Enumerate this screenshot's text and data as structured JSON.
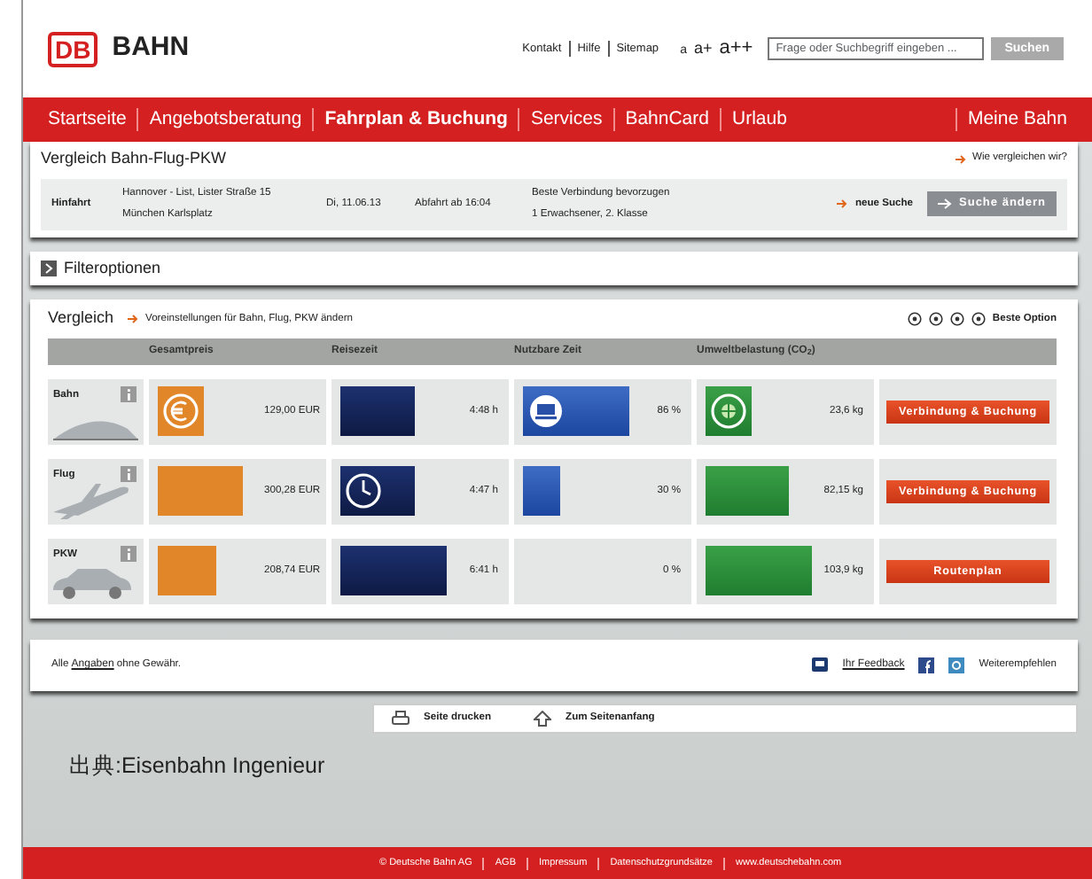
{
  "header": {
    "logo_mark": "DB",
    "logo_text": "BAHN",
    "links": [
      "Kontakt",
      "Hilfe",
      "Sitemap"
    ],
    "font_sizes": [
      "a",
      "a+",
      "a++"
    ],
    "search": {
      "placeholder": "Frage oder Suchbegriff eingeben ..."
    },
    "search_button": "Suchen"
  },
  "nav": {
    "items": [
      {
        "label": "Startseite",
        "selected": false
      },
      {
        "label": "Angebotsberatung",
        "selected": false
      },
      {
        "label": "Fahrplan & Buchung",
        "selected": true
      },
      {
        "label": "Services",
        "selected": false
      },
      {
        "label": "BahnCard",
        "selected": false
      },
      {
        "label": "Urlaub",
        "selected": false
      }
    ],
    "account": "Meine Bahn"
  },
  "search_panel": {
    "title": "Vergleich Bahn-Flug-PKW",
    "help_link": "Wie vergleichen wir?",
    "direction": "Hinfahrt",
    "from": "Hannover - List, Lister Straße 15",
    "to": "München Karlsplatz",
    "date": "Di, 11.06.13",
    "departure": "Abfahrt ab 16:04",
    "preference": "Beste Verbindung bevorzugen",
    "travellers": "1 Erwachsener, 2. Klasse",
    "new_search": "neue Suche",
    "change_button": "Suche ändern"
  },
  "filter": {
    "title": "Filteroptionen"
  },
  "comparison": {
    "title": "Vergleich",
    "settings_link": "Voreinstellungen für Bahn, Flug, PKW ändern",
    "legend": "Beste Option",
    "columns": [
      "Gesamtpreis",
      "Reisezeit",
      "Nutzbare Zeit",
      "Umweltbelastung (CO$_{2}$)"
    ],
    "rows": [
      {
        "kind": "train",
        "mode": "Bahn",
        "metrics": [
          {
            "value": "129,00 EUR",
            "best": true
          },
          {
            "value": "4:48 h",
            "best": false
          },
          {
            "value": "86 %",
            "best": true
          },
          {
            "value": "23,6 kg",
            "best": true
          }
        ],
        "action": "Verbindung & Buchung"
      },
      {
        "kind": "plane",
        "mode": "Flug",
        "metrics": [
          {
            "value": "300,28 EUR",
            "best": false
          },
          {
            "value": "4:47 h",
            "best": true
          },
          {
            "value": "30 %",
            "best": false
          },
          {
            "value": "82,15 kg",
            "best": false
          }
        ],
        "action": "Verbindung & Buchung"
      },
      {
        "kind": "car",
        "mode": "PKW",
        "metrics": [
          {
            "value": "208,74 EUR",
            "best": false
          },
          {
            "value": "6:41 h",
            "best": false
          },
          {
            "value": "0 %",
            "best": false
          },
          {
            "value": "103,9 kg",
            "best": false
          }
        ],
        "action": "Routenplan"
      }
    ]
  },
  "notice": {
    "before": "Alle ",
    "link": "Angaben",
    "after": " ohne Gewähr.",
    "feedback": "Ihr Feedback",
    "recommend": "Weiterempfehlen"
  },
  "page_tools": [
    "Seite drucken",
    "Zum Seitenanfang"
  ],
  "source_caption": "出典:Eisenbahn Ingenieur",
  "footer": [
    "© Deutsche Bahn AG",
    "AGB",
    "Impressum",
    "Datenschutzgrundsätze",
    "www.deutschebahn.com"
  ]
}
